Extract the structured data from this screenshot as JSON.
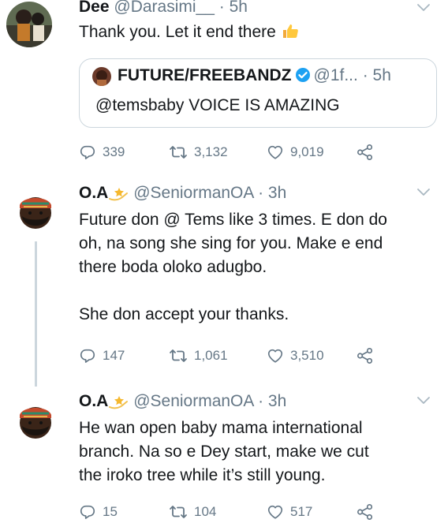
{
  "tweets": [
    {
      "name": "Dee",
      "handle": "@Darasimi__",
      "time": "· 5h",
      "text": "Thank you. Let it end there",
      "emoji": "thumbs-up",
      "quote": {
        "name": "FUTURE/FREEBANDZ",
        "handle": "@1f...",
        "time": "· 5h",
        "text": "@temsbaby VOICE IS AMAZING"
      },
      "stats": {
        "replies": "339",
        "retweets": "3,132",
        "likes": "9,019"
      }
    },
    {
      "name": "O.A",
      "handle": "@SeniormanOA",
      "time": "· 3h",
      "name_emoji": "star",
      "text_lines": [
        "Future don @ Tems like 3 times. E don do",
        "oh, na song she sing for you. Make e end",
        "there boda oloko adugbo.",
        "",
        "She don accept your thanks."
      ],
      "stats": {
        "replies": "147",
        "retweets": "1,061",
        "likes": "3,510"
      }
    },
    {
      "name": "O.A",
      "handle": "@SeniormanOA",
      "time": "· 3h",
      "name_emoji": "star",
      "text_lines": [
        "He wan open baby mama international",
        "branch. Na so e Dey start, make we cut",
        "the iroko tree while it’s still young."
      ],
      "stats": {
        "replies": "15",
        "retweets": "104",
        "likes": "517"
      }
    }
  ],
  "icons": {
    "reply": "reply-icon",
    "retweet": "retweet-icon",
    "like": "heart-icon",
    "share": "share-icon",
    "caret": "chevron-down-icon",
    "verified": "verified-badge-icon"
  },
  "colors": {
    "muted": "#657786",
    "border": "#ccd6dd",
    "verified": "#1da1f2",
    "text": "#14171a"
  }
}
